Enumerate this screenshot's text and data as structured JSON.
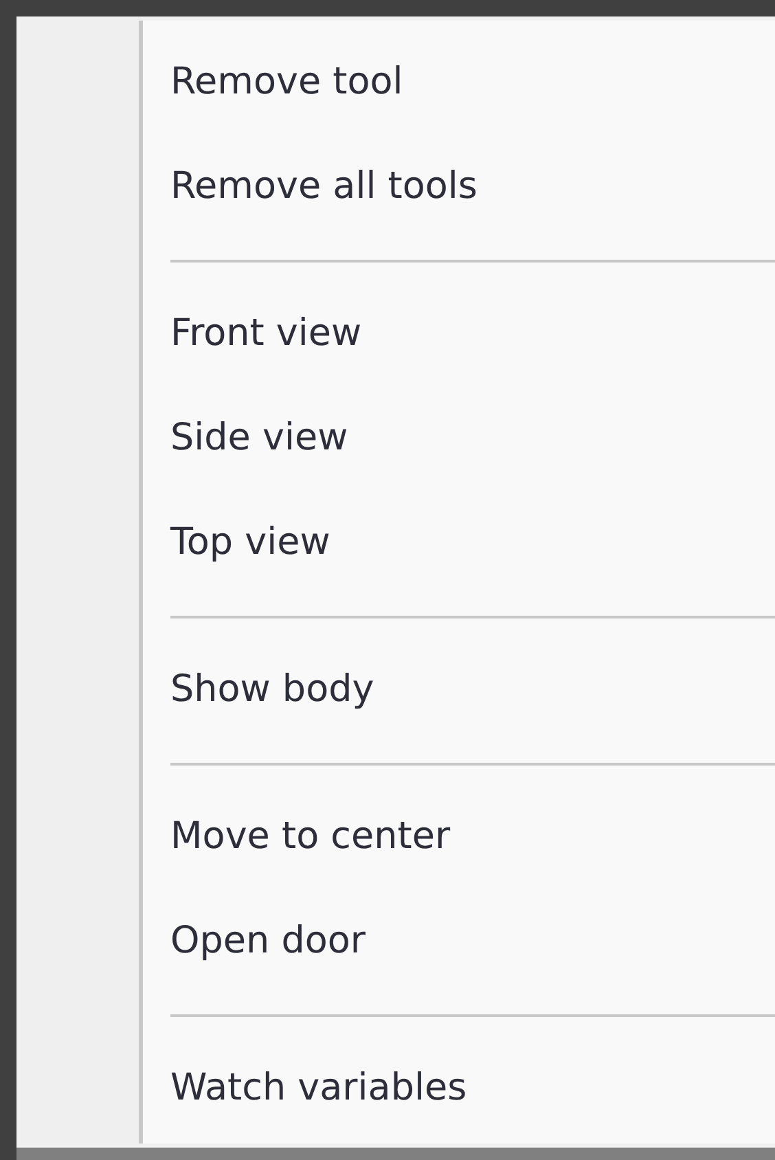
{
  "menu": {
    "items": [
      {
        "kind": "item",
        "label": "Remove tool"
      },
      {
        "kind": "item",
        "label": "Remove all tools"
      },
      {
        "kind": "separator"
      },
      {
        "kind": "item",
        "label": "Front view"
      },
      {
        "kind": "item",
        "label": "Side view"
      },
      {
        "kind": "item",
        "label": "Top view"
      },
      {
        "kind": "separator"
      },
      {
        "kind": "item",
        "label": "Show body"
      },
      {
        "kind": "separator"
      },
      {
        "kind": "item",
        "label": "Move to center"
      },
      {
        "kind": "item",
        "label": "Open door"
      },
      {
        "kind": "separator"
      },
      {
        "kind": "item",
        "label": "Watch variables"
      }
    ]
  }
}
